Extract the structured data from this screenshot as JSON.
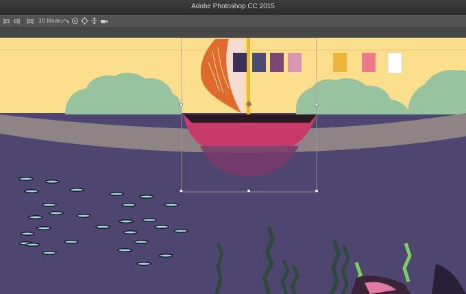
{
  "window": {
    "title": "Adobe Photoshop CC 2015"
  },
  "options_bar": {
    "mode_label": "3D Mode:",
    "tools": [
      "align-left-icon",
      "align-right-icon",
      "distribute-icon",
      "rotate-3d-icon",
      "roll-3d-icon",
      "pan-3d-icon",
      "slide-3d-icon",
      "scale-3d-icon"
    ]
  },
  "palette": {
    "swatches": [
      "#3c3058",
      "#4a4a72",
      "#7a4a72",
      "#d896b4",
      "#ecb63a",
      "#ec7a8a",
      "#ffffff"
    ]
  },
  "colors": {
    "sky": "#fcdf8c",
    "hills": "#97c39f",
    "horizon": "#8e8486",
    "sea": "#4e4670",
    "sail": "#de6a2c",
    "mast": "#f0b830",
    "hull": "#c83a6a",
    "hull_deck": "#2a1a20",
    "fish": "#9ad4e4",
    "weeds": "#2c4a3a",
    "weeds_light": "#7ed05a",
    "selection": "#8a8a8a"
  },
  "transform_box": {
    "active": true
  }
}
